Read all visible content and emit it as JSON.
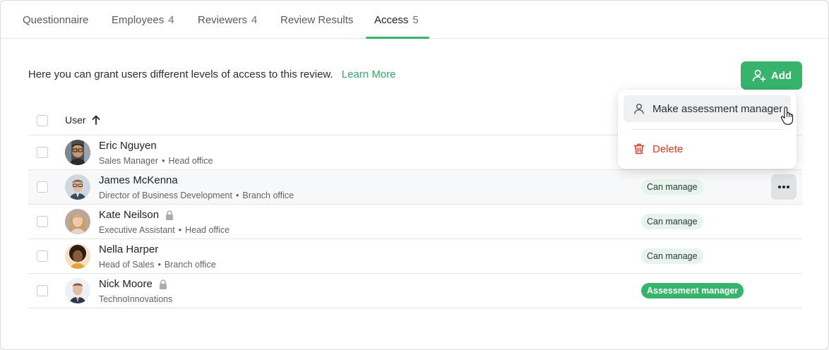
{
  "tabs": [
    {
      "label": "Questionnaire",
      "count": ""
    },
    {
      "label": "Employees",
      "count": "4"
    },
    {
      "label": "Reviewers",
      "count": "4"
    },
    {
      "label": "Review Results",
      "count": ""
    },
    {
      "label": "Access",
      "count": "5"
    }
  ],
  "active_tab": "Access",
  "intro": {
    "text": "Here you can grant users different levels of access to this review.",
    "link": "Learn More"
  },
  "add_button": {
    "label": "Add",
    "icon": "add-user-icon"
  },
  "table": {
    "header_user": "User",
    "sort": "ascending",
    "rows": [
      {
        "name": "Eric Nguyen",
        "title": "Sales Manager",
        "office": "Head office",
        "locked": false,
        "role": ""
      },
      {
        "name": "James McKenna",
        "title": "Director of Business Development",
        "office": "Branch office",
        "locked": false,
        "role": "Can manage"
      },
      {
        "name": "Kate Neilson",
        "title": "Executive Assistant",
        "office": "Head office",
        "locked": true,
        "role": "Can manage"
      },
      {
        "name": "Nella Harper",
        "title": "Head of Sales",
        "office": "Branch office",
        "locked": false,
        "role": "Can manage"
      },
      {
        "name": "Nick Moore",
        "title": "TechnoInnovations",
        "office": "",
        "locked": true,
        "role": "Assessment manager"
      }
    ]
  },
  "menu": {
    "make_manager": "Make assessment manager",
    "delete": "Delete"
  },
  "separator": "•",
  "colors": {
    "accent": "#36b46c",
    "danger": "#d14025",
    "badge_bg": "#e6f4ec"
  }
}
